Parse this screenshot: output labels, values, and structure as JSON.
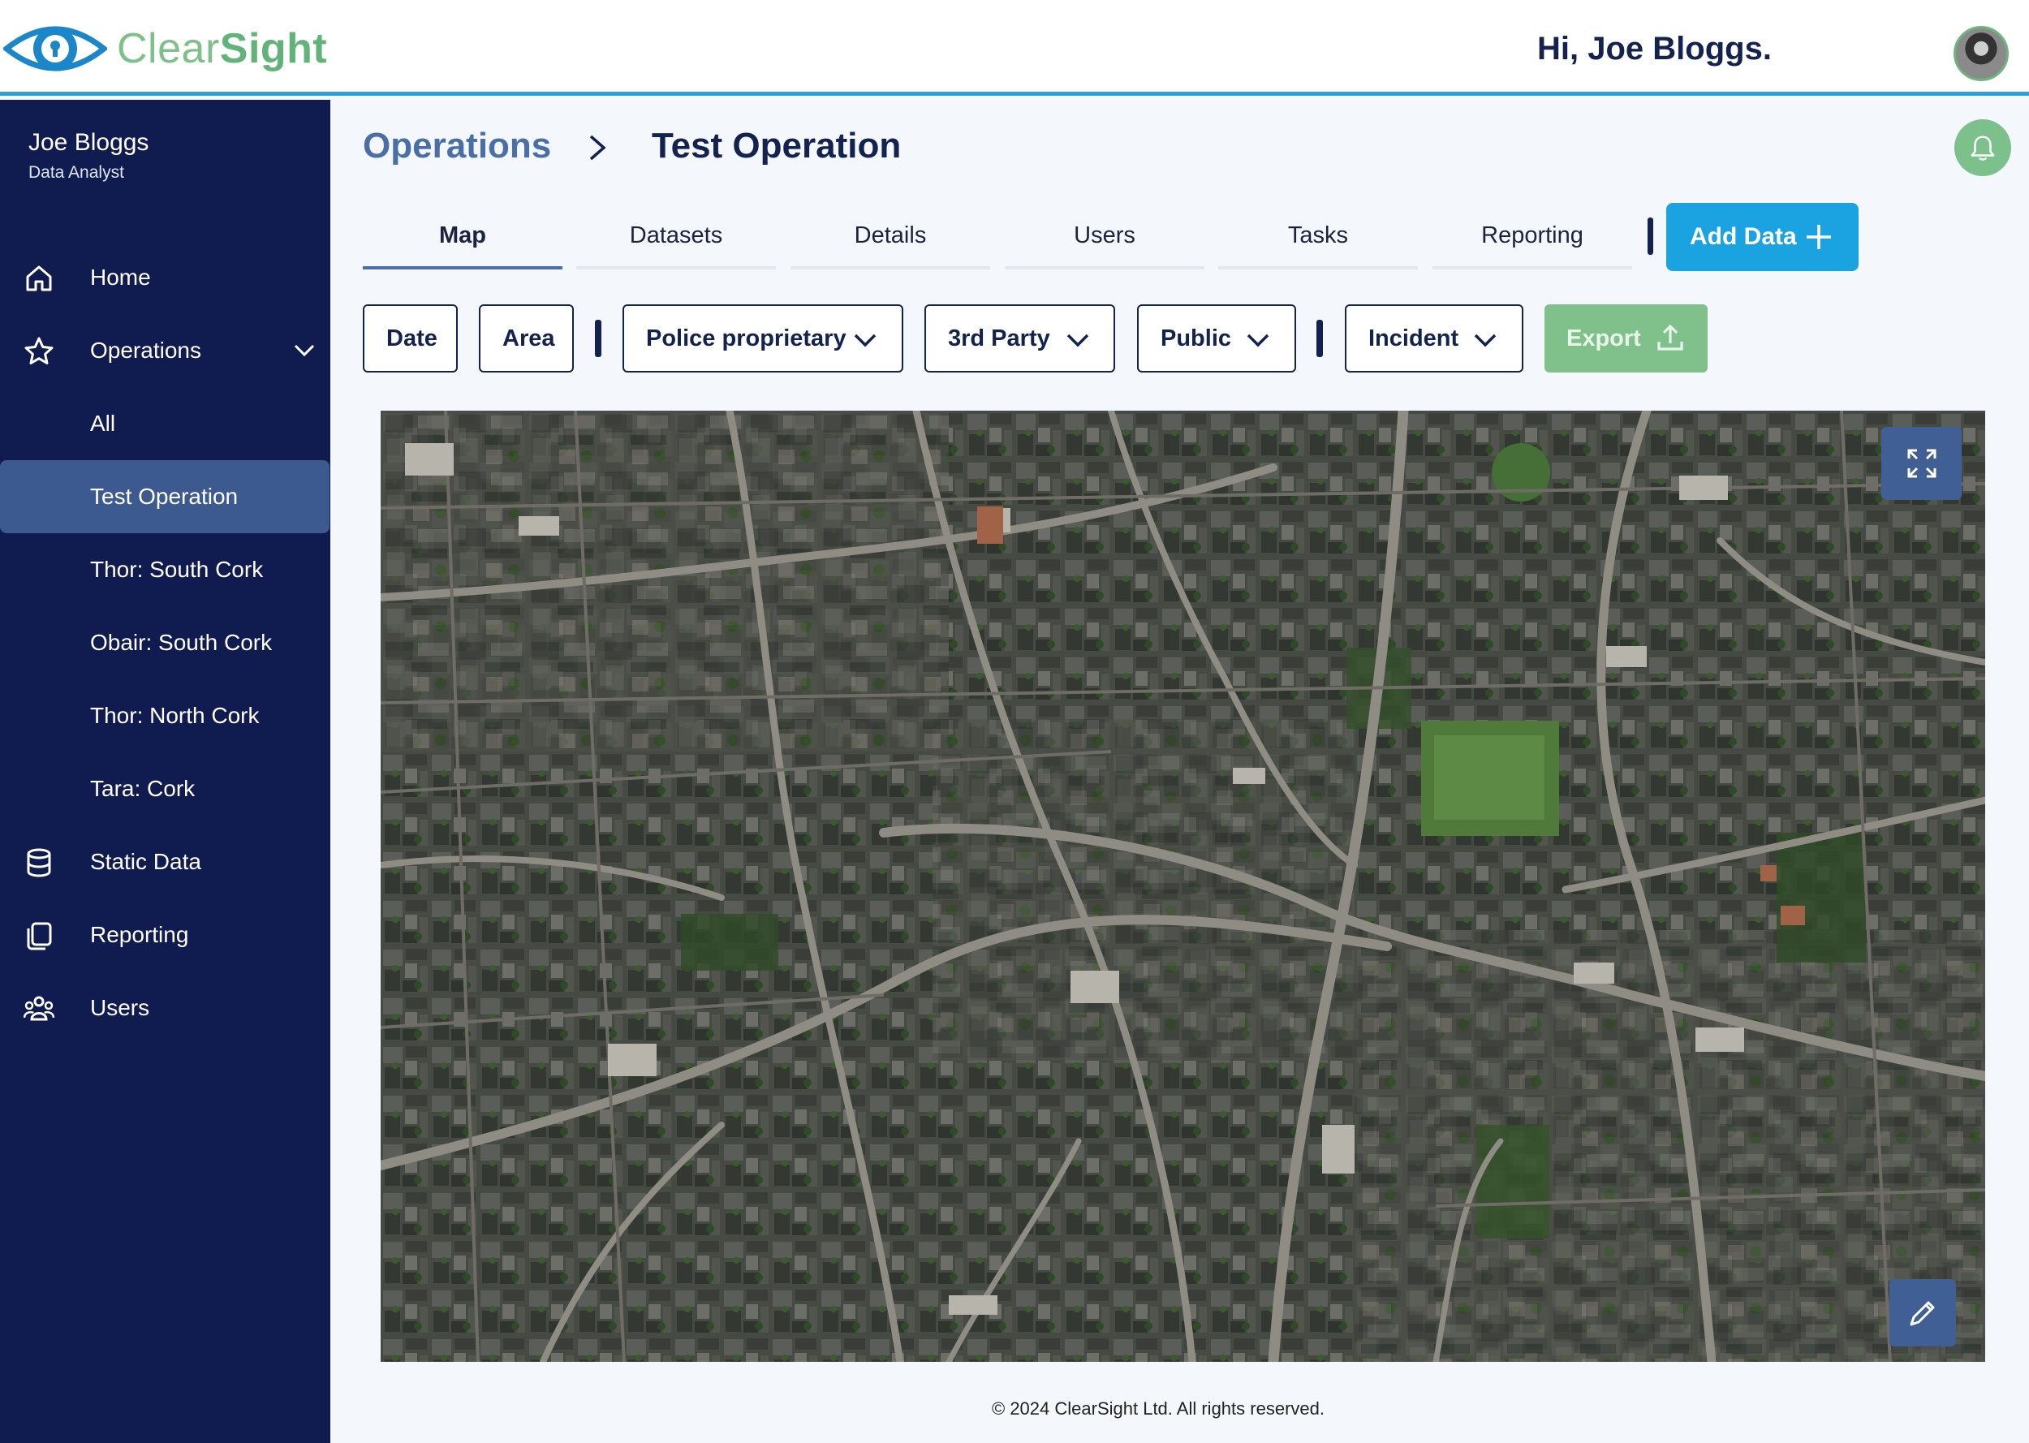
{
  "header": {
    "brand_clear": "Clear",
    "brand_sight": "Sight",
    "greeting": "Hi, Joe Bloggs.",
    "avatar_icon": "user-avatar"
  },
  "sidebar": {
    "user_name": "Joe Bloggs",
    "user_role": "Data Analyst",
    "items": [
      {
        "label": "Home",
        "icon": "home-icon"
      },
      {
        "label": "Operations",
        "icon": "star-icon",
        "expanded": true
      },
      {
        "label": "All"
      },
      {
        "label": "Test Operation",
        "active": true
      },
      {
        "label": "Thor: South Cork"
      },
      {
        "label": "Obair: South Cork"
      },
      {
        "label": "Thor: North Cork"
      },
      {
        "label": "Tara: Cork"
      },
      {
        "label": "Static Data",
        "icon": "database-icon"
      },
      {
        "label": "Reporting",
        "icon": "documents-icon"
      },
      {
        "label": "Users",
        "icon": "users-icon"
      }
    ]
  },
  "breadcrumb": {
    "parent": "Operations",
    "current": "Test Operation"
  },
  "tabs": [
    {
      "label": "Map",
      "active": true
    },
    {
      "label": "Datasets"
    },
    {
      "label": "Details"
    },
    {
      "label": "Users"
    },
    {
      "label": "Tasks"
    },
    {
      "label": "Reporting"
    }
  ],
  "actions": {
    "add_data": "Add Data",
    "export": "Export"
  },
  "filters": {
    "date": "Date",
    "area": "Area",
    "police": "Police proprietary",
    "third_party": "3rd Party",
    "public": "Public",
    "incident": "Incident"
  },
  "colors": {
    "sidebar_bg": "#101b4f",
    "accent_blue": "#1aa3e0",
    "accent_green": "#7cc08b",
    "active_item": "#3c5a90",
    "header_rule": "#2a9fd8"
  },
  "footer": {
    "copyright": "© 2024 ClearSight Ltd. All rights reserved."
  }
}
